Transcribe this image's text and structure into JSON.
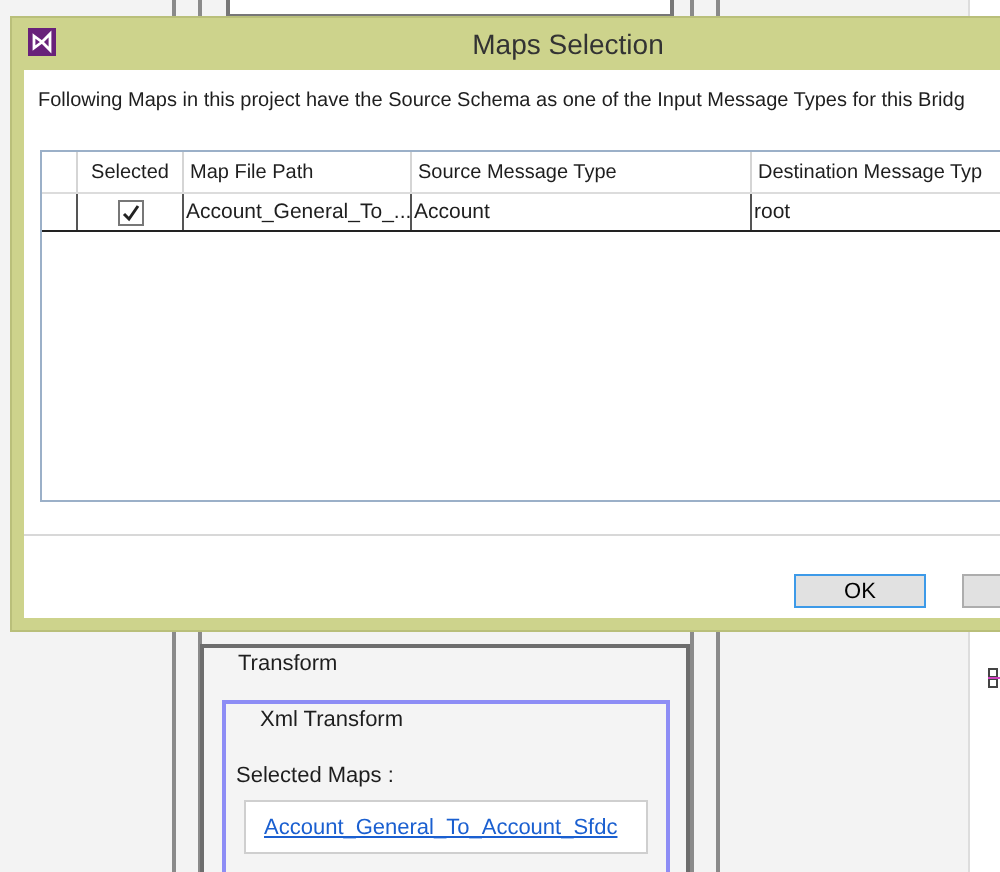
{
  "dialog": {
    "title": "Maps Selection",
    "message": "Following Maps in this project have the Source Schema as one of the Input Message Types for this Bridg",
    "table": {
      "columns": [
        "Selected",
        "Map File Path",
        "Source Message Type",
        "Destination Message Typ"
      ],
      "rows": [
        {
          "checked": true,
          "cells": [
            "",
            "Account_General_To_...",
            "Account",
            "root"
          ]
        }
      ]
    },
    "buttons": [
      "OK"
    ]
  },
  "canvas": {
    "stage": {
      "title": "Transform",
      "step": {
        "title": "Xml Transform",
        "label": "Selected Maps :",
        "maps": [
          "Account_General_To_Account_Sfdc"
        ]
      }
    }
  }
}
